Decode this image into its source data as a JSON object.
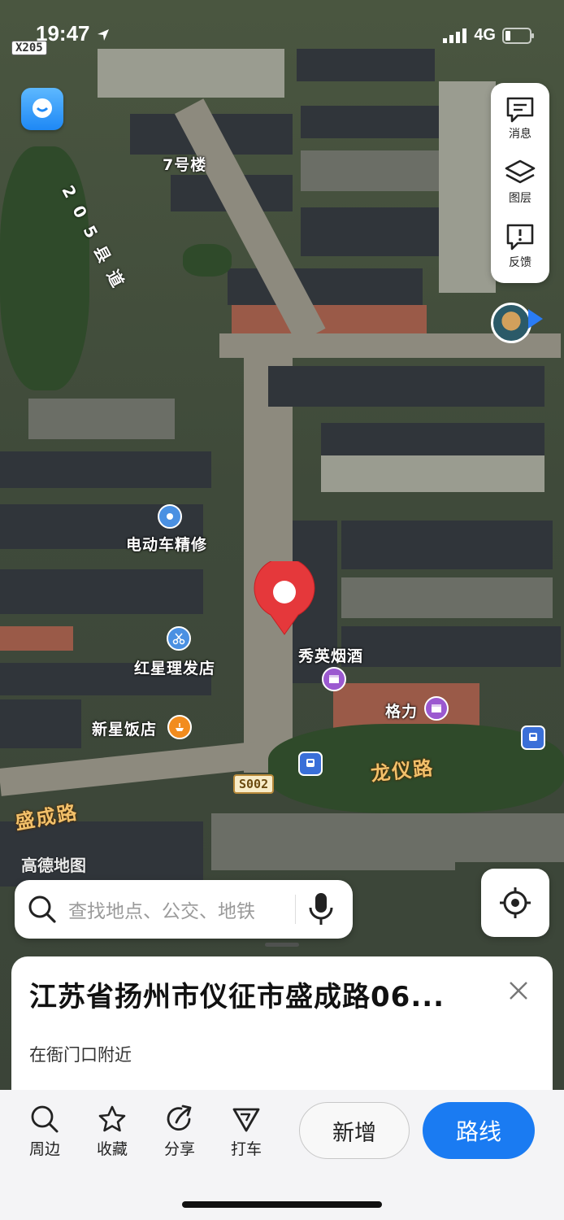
{
  "status_bar": {
    "time": "19:47",
    "network": "4G",
    "road_shield": "X205"
  },
  "map": {
    "labels": {
      "building_7": "7号楼",
      "county_road": "205县道",
      "ev_repair": "电动车精修",
      "barber": "红星理发店",
      "restaurant": "新星饭店",
      "tobacco": "秀英烟酒",
      "gree": "格力",
      "shengcheng_road": "盛成路",
      "longyi_road": "龙仪路",
      "s002": "S002"
    },
    "watermark": "高德地图",
    "colors": {
      "marker": "#e5383b",
      "accent": "#1a7bf2",
      "poi_blue": "#4a90e2",
      "poi_orange": "#f28c1e",
      "poi_purple": "#9b59d0"
    }
  },
  "toolbar": {
    "messages": "消息",
    "layers": "图层",
    "feedback": "反馈"
  },
  "search": {
    "placeholder": "查找地点、公交、地铁"
  },
  "card": {
    "title": "江苏省扬州市仪征市盛成路06...",
    "subtitle": "在衙门口附近"
  },
  "actions": {
    "nearby": "周边",
    "favorite": "收藏",
    "share": "分享",
    "taxi": "打车",
    "add": "新增",
    "route": "路线"
  }
}
